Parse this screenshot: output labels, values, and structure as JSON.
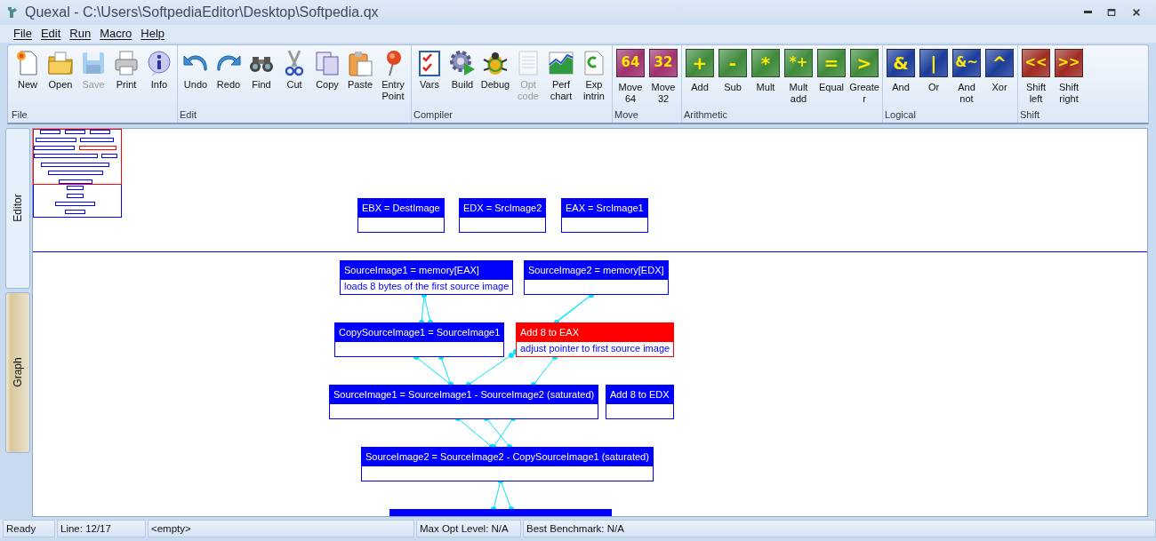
{
  "window": {
    "title": "Quexal - C:\\Users\\SoftpediaEditor\\Desktop\\Softpedia.qx"
  },
  "menu": [
    "File",
    "Edit",
    "Run",
    "Macro",
    "Help"
  ],
  "ribbon": [
    {
      "label": "File",
      "kind": "icons",
      "buttons": [
        {
          "label": "New",
          "disabled": false
        },
        {
          "label": "Open",
          "disabled": false
        },
        {
          "label": "Save",
          "disabled": true
        },
        {
          "label": "Print",
          "disabled": false
        },
        {
          "label": "Info",
          "disabled": false
        }
      ]
    },
    {
      "label": "Edit",
      "kind": "icons",
      "buttons": [
        {
          "label": "Undo",
          "disabled": false
        },
        {
          "label": "Redo",
          "disabled": false
        },
        {
          "label": "Find",
          "disabled": false
        },
        {
          "label": "Cut",
          "disabled": false
        },
        {
          "label": "Copy",
          "disabled": false
        },
        {
          "label": "Paste",
          "disabled": false
        },
        {
          "label": "Entry Point",
          "disabled": false
        }
      ]
    },
    {
      "label": "Compiler",
      "kind": "icons",
      "buttons": [
        {
          "label": "Vars",
          "disabled": false
        },
        {
          "label": "Build",
          "disabled": false
        },
        {
          "label": "Debug",
          "disabled": false
        },
        {
          "label": "Opt code",
          "disabled": true
        },
        {
          "label": "Perf chart",
          "disabled": false
        },
        {
          "label": "Exp intrin",
          "disabled": false
        }
      ]
    },
    {
      "label": "Move",
      "kind": "tiles",
      "color": "#a0306e",
      "buttons": [
        {
          "label": "Move 64",
          "glyph": "64",
          "disabled": false
        },
        {
          "label": "Move 32",
          "glyph": "32",
          "disabled": false
        }
      ]
    },
    {
      "label": "Arithmetic",
      "kind": "tiles",
      "color": "#3f8a3a",
      "buttons": [
        {
          "label": "Add",
          "glyph": "+",
          "disabled": false
        },
        {
          "label": "Sub",
          "glyph": "-",
          "disabled": false
        },
        {
          "label": "Mult",
          "glyph": "*",
          "disabled": false
        },
        {
          "label": "Mult add",
          "glyph": "*+",
          "disabled": false
        },
        {
          "label": "Equal",
          "glyph": "=",
          "disabled": false
        },
        {
          "label": "Greater",
          "glyph": ">",
          "disabled": false
        }
      ]
    },
    {
      "label": "Logical",
      "kind": "tiles",
      "color": "#1c3c9a",
      "buttons": [
        {
          "label": "And",
          "glyph": "&",
          "disabled": false
        },
        {
          "label": "Or",
          "glyph": "|",
          "disabled": false
        },
        {
          "label": "And not",
          "glyph": "&~",
          "disabled": false
        },
        {
          "label": "Xor",
          "glyph": "^",
          "disabled": false
        }
      ]
    },
    {
      "label": "Shift",
      "kind": "tiles",
      "color": "#a02a22",
      "buttons": [
        {
          "label": "Shift left",
          "glyph": "<<",
          "disabled": false
        },
        {
          "label": "Shift right",
          "glyph": ">>",
          "disabled": false
        }
      ]
    }
  ],
  "side_tabs": [
    {
      "label": "Editor",
      "selected": false
    },
    {
      "label": "Graph",
      "selected": true
    }
  ],
  "graph": {
    "nodes": [
      {
        "kind": "box",
        "title": "EBX = DestImage",
        "selected": false
      },
      {
        "kind": "box",
        "title": "EDX = SrcImage2",
        "selected": false
      },
      {
        "kind": "box",
        "title": "EAX = SrcImage1",
        "selected": false
      },
      {
        "kind": "box",
        "title": "SourceImage1 = memory[EAX]",
        "comment": "loads 8 bytes of the first source image",
        "selected": false
      },
      {
        "kind": "box",
        "title": "SourceImage2 = memory[EDX]",
        "selected": false
      },
      {
        "kind": "box",
        "title": "CopySourceImage1 = SourceImage1",
        "selected": false
      },
      {
        "kind": "box",
        "title": "Add 8 to EAX",
        "comment": "adjust pointer to first source image",
        "selected": true
      },
      {
        "kind": "box",
        "title": "SourceImage1 = SourceImage1 - SourceImage2 (saturated)",
        "selected": false
      },
      {
        "kind": "box",
        "title": "Add 8 to EDX",
        "selected": false
      },
      {
        "kind": "box",
        "title": "SourceImage2 = SourceImage2 - CopySourceImage1 (saturated)",
        "selected": false
      },
      {
        "kind": "clipped",
        "selected": false
      }
    ]
  },
  "status_bar": [
    "Ready",
    "Line: 12/17",
    "<empty>",
    "Max Opt Level: N/A",
    "Best Benchmark: N/A"
  ]
}
